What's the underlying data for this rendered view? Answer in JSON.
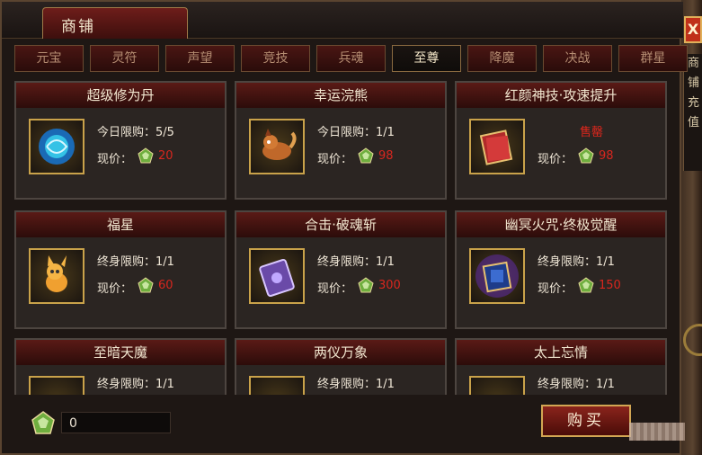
{
  "window": {
    "title": "商铺",
    "close_label": "X"
  },
  "side_panel": {
    "chars": [
      "商",
      "铺",
      "",
      "充",
      "值"
    ]
  },
  "tabs": [
    "元宝",
    "灵符",
    "声望",
    "竞技",
    "兵魂",
    "至尊",
    "降魔",
    "决战",
    "群星"
  ],
  "active_tab": "至尊",
  "price_label": "现价：",
  "items": [
    {
      "name": "超级修为丹",
      "limit": "今日限购：5/5",
      "price": "20",
      "icon": "blue-orb-icon"
    },
    {
      "name": "幸运浣熊",
      "limit": "今日限购：1/1",
      "price": "98",
      "icon": "raccoon-pet-icon"
    },
    {
      "name": "红颜神技·攻速提升",
      "limit": "",
      "soldout": "售罄",
      "price": "98",
      "icon": "red-book-icon"
    },
    {
      "name": "福星",
      "limit": "终身限购：1/1",
      "price": "60",
      "icon": "fox-pet-icon"
    },
    {
      "name": "合击·破魂斩",
      "limit": "终身限购：1/1",
      "price": "300",
      "icon": "purple-scroll-icon"
    },
    {
      "name": "幽冥火咒·终极觉醒",
      "limit": "终身限购：1/1",
      "price": "150",
      "icon": "blue-tome-icon"
    },
    {
      "name": "至暗天魔",
      "limit": "终身限购：1/1",
      "price": "",
      "icon": "dark-demon-icon"
    },
    {
      "name": "两仪万象",
      "limit": "终身限购：1/1",
      "price": "",
      "icon": "dual-symbol-icon"
    },
    {
      "name": "太上忘情",
      "limit": "终身限购：1/1",
      "price": "",
      "icon": "sect-book-icon"
    }
  ],
  "bottom": {
    "balance": "0",
    "buy_label": "购买"
  },
  "colors": {
    "price": "#d8261e",
    "soldout": "#e0261c",
    "accent_gold": "#c9a24a",
    "header_red": "#5a1a16"
  }
}
